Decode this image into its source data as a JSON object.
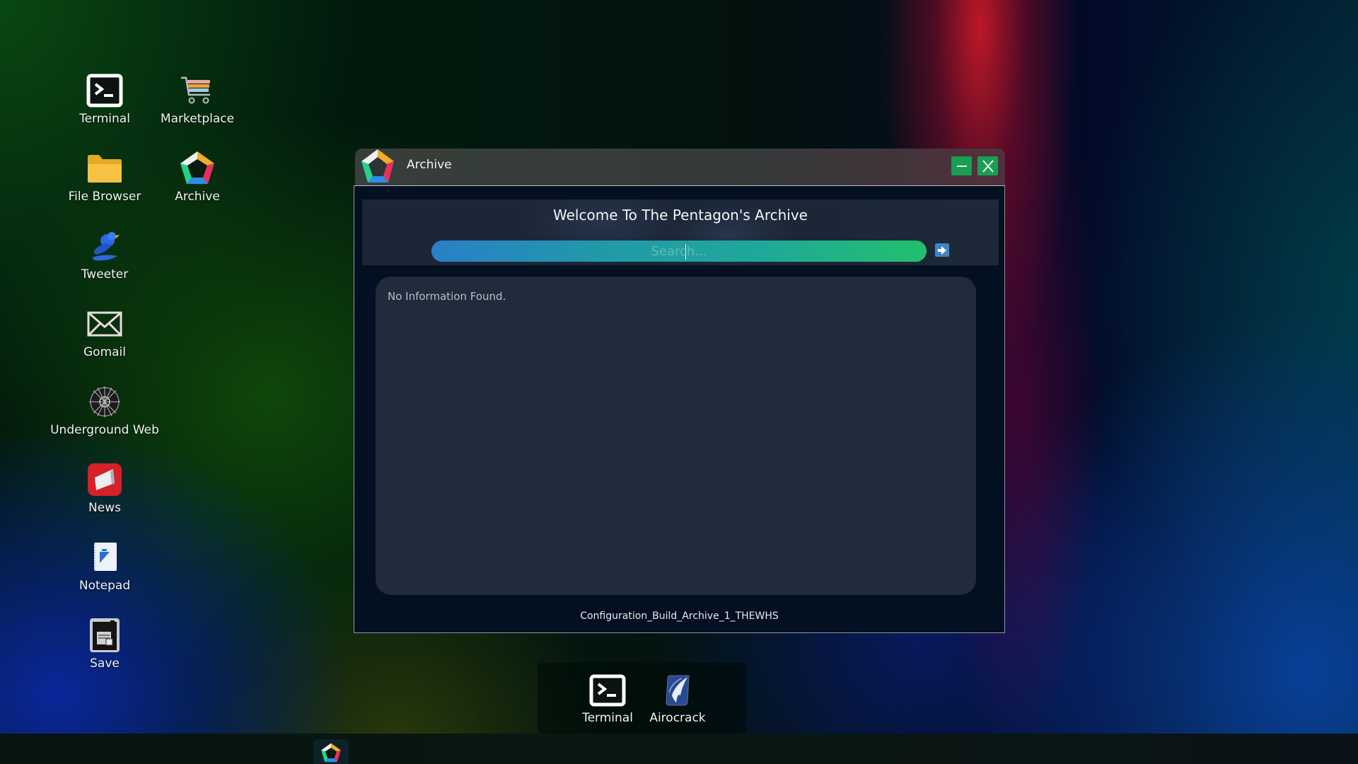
{
  "desktop": {
    "icons": [
      {
        "label": "Terminal",
        "icon": "terminal-icon"
      },
      {
        "label": "Marketplace",
        "icon": "shopping-cart-icon"
      },
      {
        "label": "File Browser",
        "icon": "folder-icon"
      },
      {
        "label": "Archive",
        "icon": "pentagon-logo-icon"
      },
      {
        "label": "Tweeter",
        "icon": "bird-icon"
      },
      {
        "label": "Gomail",
        "icon": "envelope-icon"
      },
      {
        "label": "Underground Web",
        "icon": "web-globe-icon"
      },
      {
        "label": "News",
        "icon": "news-icon"
      },
      {
        "label": "Notepad",
        "icon": "notepad-icon"
      },
      {
        "label": "Save",
        "icon": "save-icon"
      }
    ]
  },
  "window": {
    "title": "Archive",
    "minimize_label": "—",
    "close_label": "X",
    "banner_title": "Welcome To The Pentagon's Archive",
    "search": {
      "placeholder": "Search...",
      "value": ""
    },
    "results_message": "No Information Found.",
    "footer": "Configuration_Build_Archive_1_THEWHS"
  },
  "dock": {
    "items": [
      {
        "label": "Terminal",
        "icon": "terminal-icon"
      },
      {
        "label": "Airocrack",
        "icon": "airocrack-icon"
      }
    ]
  },
  "taskbar": {
    "items": [
      {
        "app": "Archive",
        "icon": "pentagon-logo-icon",
        "active": true
      }
    ]
  },
  "colors": {
    "window_body": "#031022",
    "banner": "#1d2636",
    "content_panel": "#212b3c",
    "search_gradient_start": "#2a7fc8",
    "search_gradient_end": "#22c06c",
    "window_button": "#1a9e55",
    "search_button": "#3d86c6"
  }
}
